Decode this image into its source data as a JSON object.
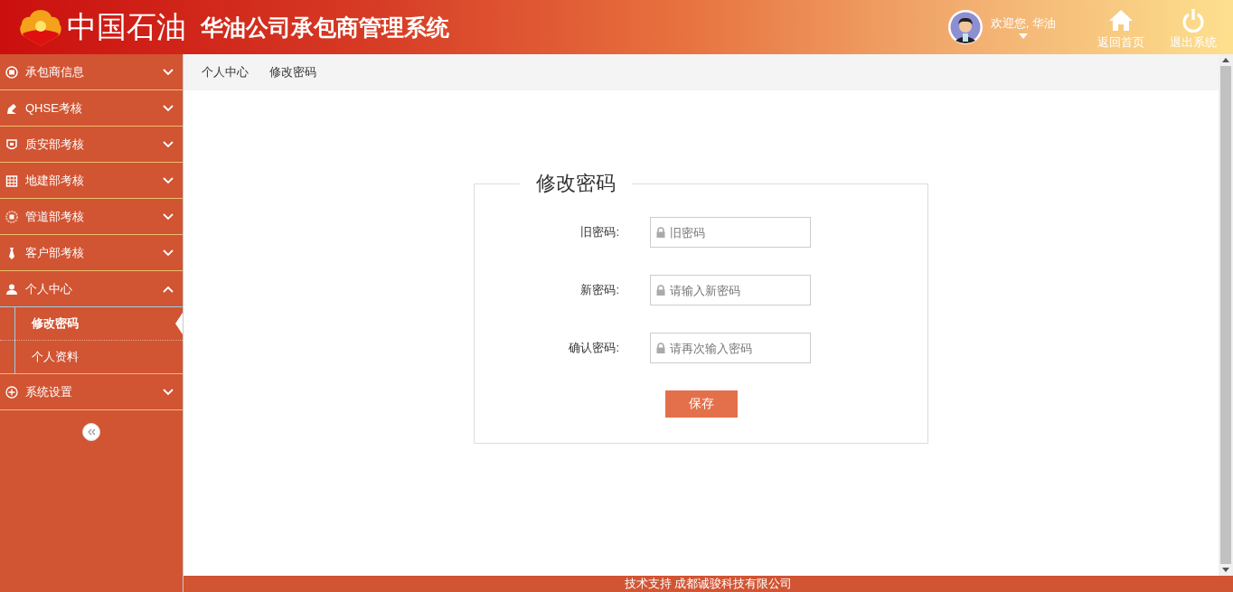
{
  "header": {
    "logo_text": "中国石油",
    "title": "华油公司承包商管理系统",
    "welcome": "欢迎您, 华油",
    "nav": [
      {
        "label": "返回首页",
        "kind": "home"
      },
      {
        "label": "退出系统",
        "kind": "power"
      }
    ]
  },
  "sidebar": {
    "items": [
      {
        "label": "承包商信息",
        "expanded": false
      },
      {
        "label": "QHSE考核",
        "expanded": false
      },
      {
        "label": "质安部考核",
        "expanded": false
      },
      {
        "label": "地建部考核",
        "expanded": false
      },
      {
        "label": "管道部考核",
        "expanded": false
      },
      {
        "label": "客户部考核",
        "expanded": false
      },
      {
        "label": "个人中心",
        "expanded": true,
        "children": [
          {
            "label": "修改密码",
            "selected": true
          },
          {
            "label": "个人资料",
            "selected": false
          }
        ]
      },
      {
        "label": "系统设置",
        "expanded": false
      }
    ]
  },
  "breadcrumb": [
    "个人中心",
    "修改密码"
  ],
  "form": {
    "legend": "修改密码",
    "fields": [
      {
        "label": "旧密码:",
        "placeholder": "旧密码"
      },
      {
        "label": "新密码:",
        "placeholder": "请输入新密码"
      },
      {
        "label": "确认密码:",
        "placeholder": "请再次输入密码"
      }
    ],
    "button": "保存"
  },
  "footer": "技术支持 成都诚骏科技有限公司"
}
